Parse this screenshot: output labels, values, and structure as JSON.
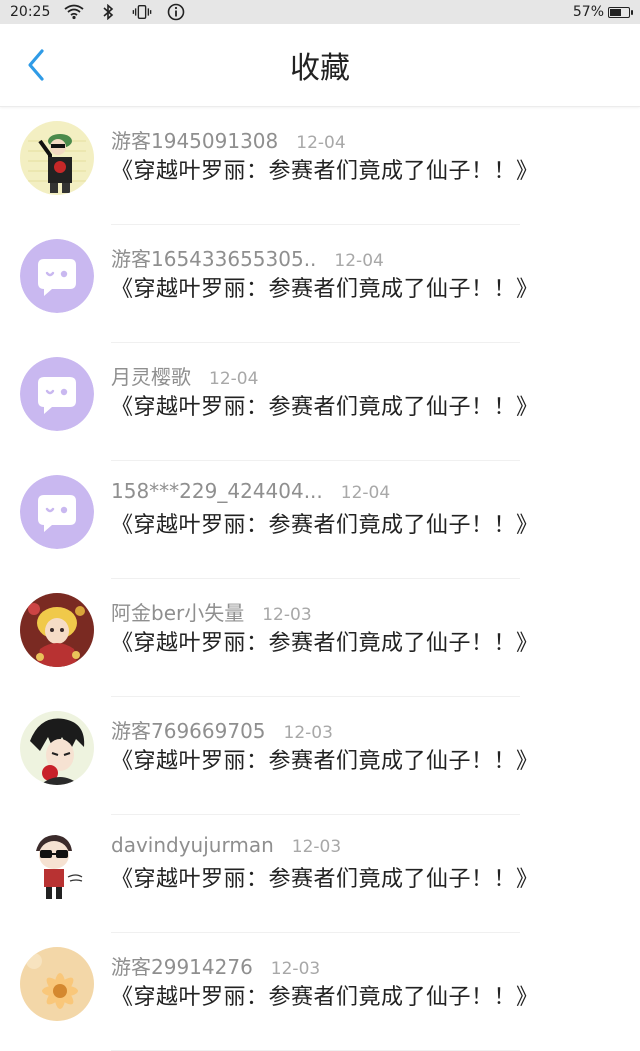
{
  "status_bar": {
    "time": "20:25",
    "battery_percent": "57%",
    "battery_level": 0.57,
    "icons": [
      "wifi-icon",
      "bluetooth-icon",
      "vibrate-icon",
      "info-icon",
      "battery-icon"
    ]
  },
  "header": {
    "title": "收藏",
    "back_icon": "chevron-left-icon"
  },
  "colors": {
    "accent": "#2f9be6",
    "placeholder_avatar": "#c9b8f0"
  },
  "favorites": [
    {
      "user": "游客1945091308",
      "date": "12-04",
      "novel": "《穿越叶罗丽：参赛者们竟成了仙子！！》",
      "avatar": "cartoon-boy-avatar"
    },
    {
      "user": "游客165433655305..",
      "date": "12-04",
      "novel": "《穿越叶罗丽：参赛者们竟成了仙子！！》",
      "avatar": "default-chat-avatar"
    },
    {
      "user": "月灵樱歌",
      "date": "12-04",
      "novel": "《穿越叶罗丽：参赛者们竟成了仙子！！》",
      "avatar": "default-chat-avatar"
    },
    {
      "user": "158***229_424404...",
      "date": "12-04",
      "novel": "《穿越叶罗丽：参赛者们竟成了仙子！！》",
      "avatar": "default-chat-avatar"
    },
    {
      "user": "阿金ber小失量",
      "date": "12-03",
      "novel": "《穿越叶罗丽：参赛者们竟成了仙子！！》",
      "avatar": "anime-girl-avatar"
    },
    {
      "user": "游客769669705",
      "date": "12-03",
      "novel": "《穿越叶罗丽：参赛者们竟成了仙子！！》",
      "avatar": "anime-boy-avatar"
    },
    {
      "user": "davindyujurman",
      "date": "12-03",
      "novel": "《穿越叶罗丽：参赛者们竟成了仙子！！》",
      "avatar": "hello-character-avatar"
    },
    {
      "user": "游客29914276",
      "date": "12-03",
      "novel": "《穿越叶罗丽：参赛者们竟成了仙子！！》",
      "avatar": "flower-avatar"
    }
  ]
}
